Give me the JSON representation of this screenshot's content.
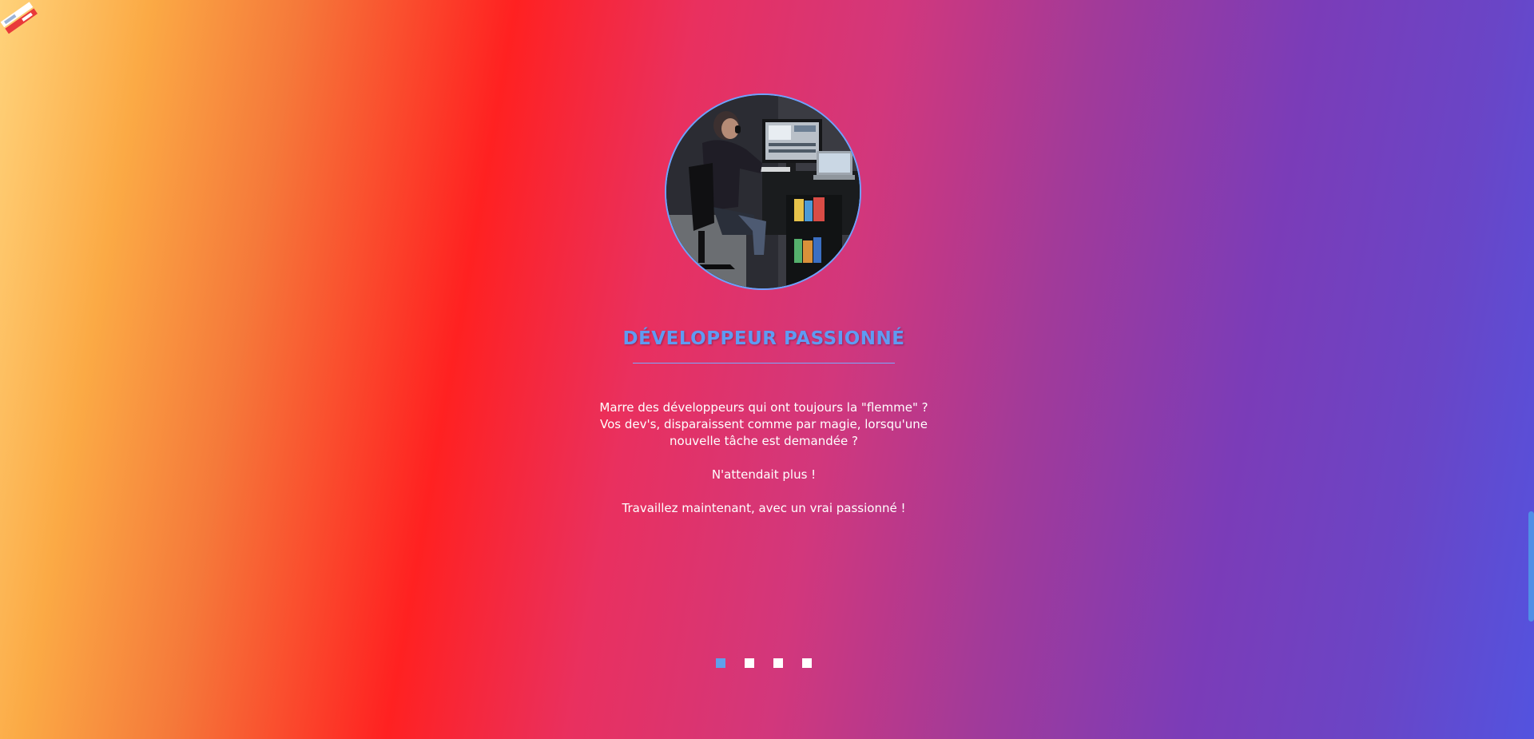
{
  "slide": {
    "title": "DÉVELOPPEUR PASSIONNÉ",
    "lines": [
      "Marre des développeurs qui ont toujours la \"flemme\" ?",
      "Vos dev's, disparaissent comme par magie, lorsqu'une",
      "nouvelle tâche est demandée ?",
      "N'attendait plus !",
      "Travaillez maintenant, avec un vrai passionné !"
    ]
  },
  "carousel": {
    "slide_count": 4,
    "active_index": 0
  },
  "colors": {
    "accent": "#5f9bf2",
    "active_dot": "#5fa0ea",
    "text": "#ffffff"
  },
  "icons": {
    "logo": "site-logo-icon"
  }
}
